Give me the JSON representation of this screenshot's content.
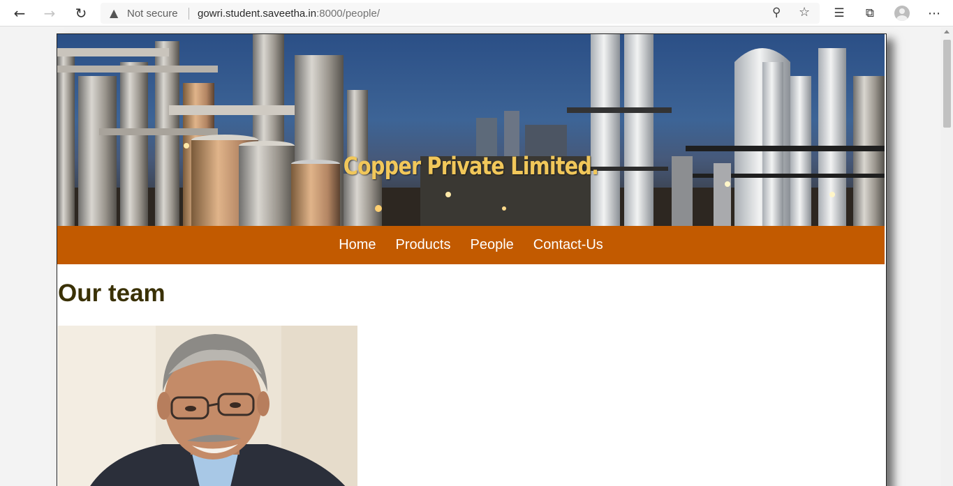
{
  "browser": {
    "security_label": "Not secure",
    "url_host": "gowri.student.saveetha.in",
    "url_rest": ":8000/people/",
    "icons": [
      "back-icon",
      "forward-icon",
      "refresh-icon",
      "warning-icon",
      "zoom-icon",
      "favorite-star-icon",
      "favorites-list-icon",
      "collections-icon",
      "profile-avatar",
      "more-icon"
    ]
  },
  "site": {
    "banner_title": "Copper Private Limited.",
    "nav": [
      "Home",
      "Products",
      "People",
      "Contact-Us"
    ],
    "heading": "Our team"
  },
  "colors": {
    "nav_bg": "#c25a00",
    "banner_title": "#f1c75a",
    "heading": "#3a3106"
  }
}
